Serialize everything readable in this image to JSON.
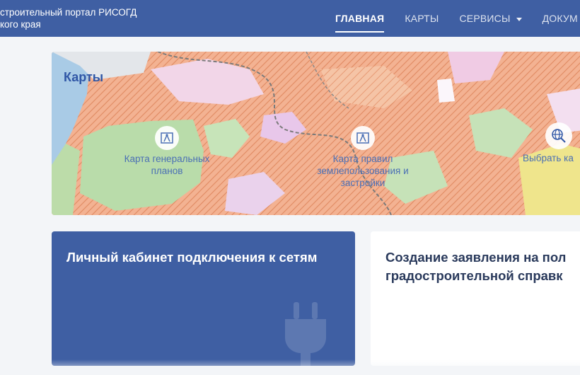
{
  "header": {
    "brand_line1": "строительный портал РИСОГД",
    "brand_line2": "кого края",
    "nav": [
      {
        "label": "ГЛАВНАЯ",
        "active": true
      },
      {
        "label": "КАРТЫ"
      },
      {
        "label": "СЕРВИСЫ",
        "has_dropdown": true
      },
      {
        "label": "ДОКУМ"
      }
    ]
  },
  "maps": {
    "title": "Карты",
    "links": [
      {
        "label": "Карта генеральных планов",
        "icon": "map-pin-icon"
      },
      {
        "label": "Карта правил землепользования и застройки",
        "icon": "map-pin-icon"
      },
      {
        "label": "Выбрать ка",
        "icon": "globe-search-icon"
      }
    ]
  },
  "cards": {
    "connect": {
      "title": "Личный кабинет подключения к сетям",
      "icon": "plug-icon"
    },
    "application": {
      "title_line1": "Создание заявления на пол",
      "title_line2": "градостроительной справк"
    }
  },
  "colors": {
    "header_bg": "#3f5fa3",
    "accent": "#2f56a6",
    "map_orange": "#f0a27c",
    "map_green": "#b9dcaa"
  }
}
